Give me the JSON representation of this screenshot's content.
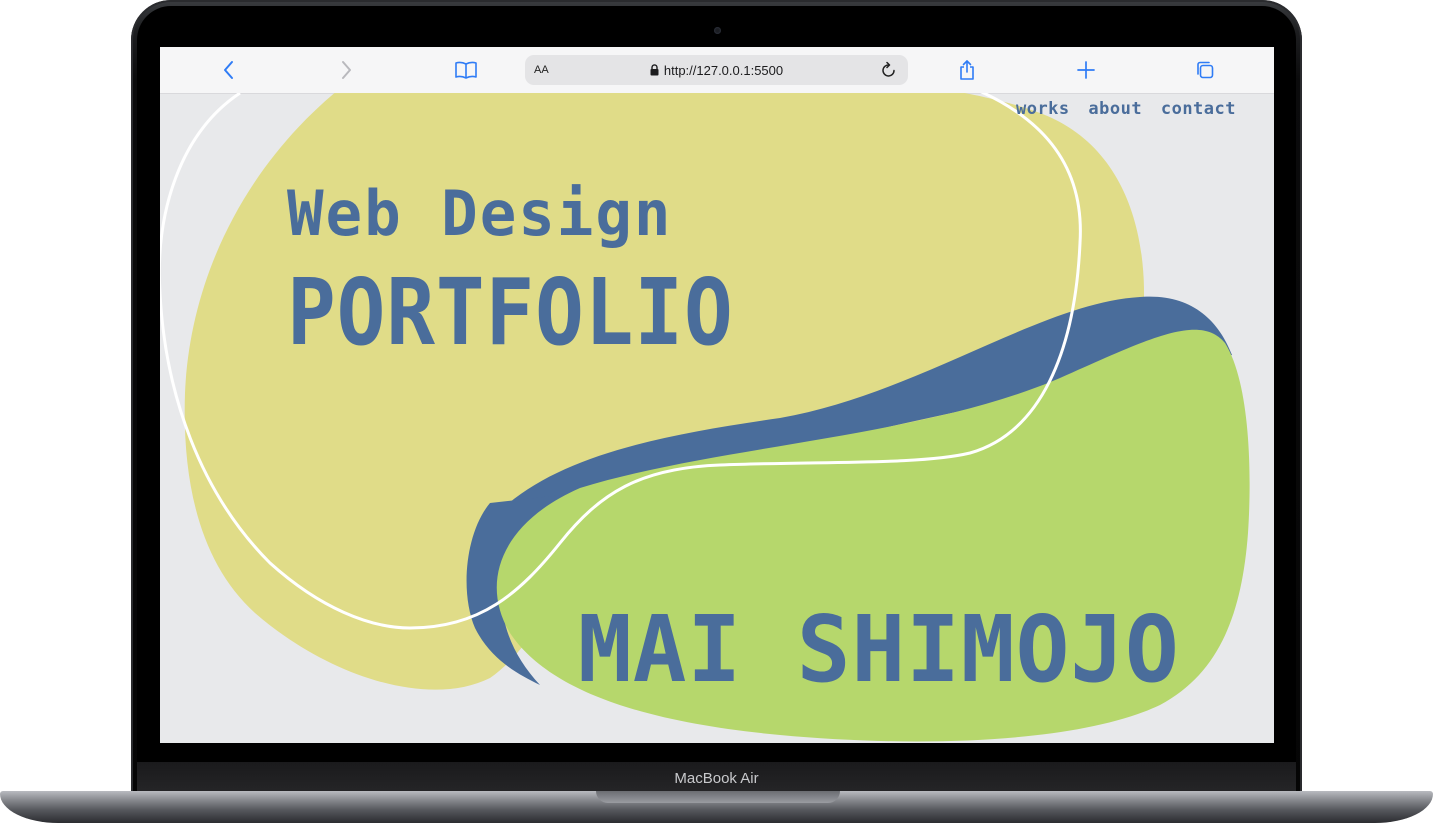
{
  "device": {
    "label": "MacBook Air"
  },
  "browser": {
    "text_size_label": "AA",
    "url": "http://127.0.0.1:5500",
    "icons": [
      "chevron-left-icon",
      "chevron-right-icon",
      "bookmarks-book-icon",
      "lock-icon",
      "reload-icon",
      "share-icon",
      "plus-icon",
      "tabs-icon"
    ]
  },
  "site": {
    "nav": [
      "works",
      "about",
      "contact"
    ],
    "heading_line1": "Web Design",
    "heading_line2": "PORTFOLIO",
    "name": "MAI SHIMOJO"
  },
  "colors": {
    "page_bg": "#e8e9eb",
    "yellow_blob": "#e0dc88",
    "green_blob": "#b6d76c",
    "accent_blue": "#4a6d9b",
    "outline": "#ffffff",
    "browser_accent": "#2f7cf6"
  }
}
